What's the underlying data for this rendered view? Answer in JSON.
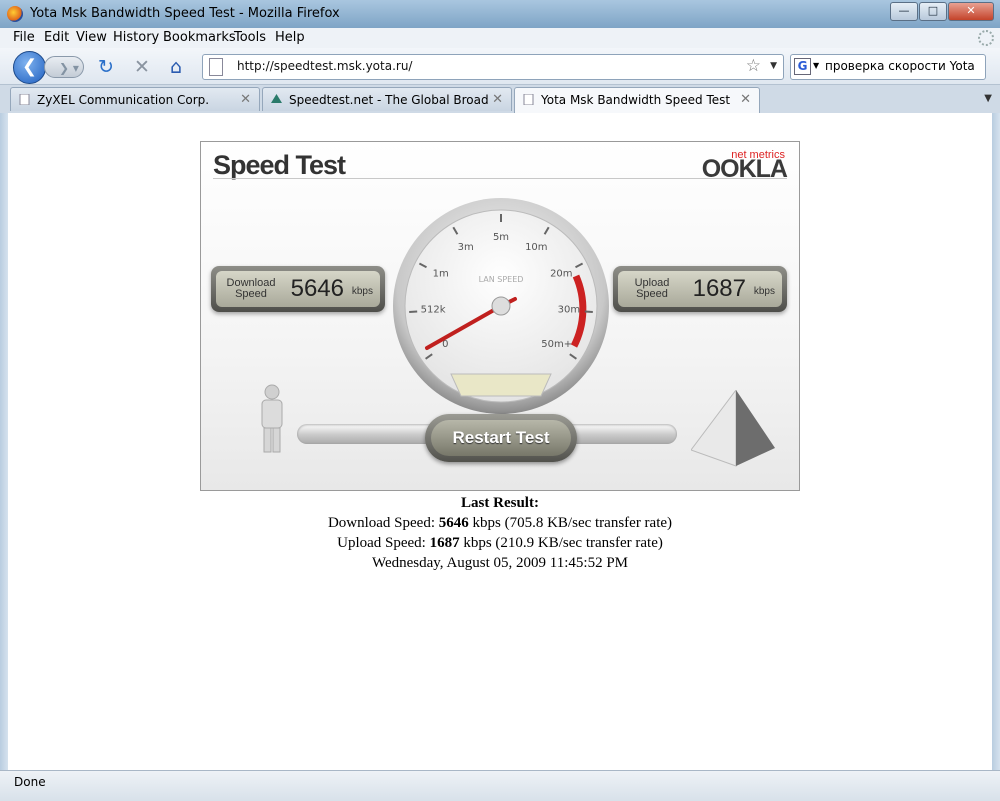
{
  "window": {
    "title": "Yota Msk Bandwidth Speed Test - Mozilla Firefox"
  },
  "menu": [
    "File",
    "Edit",
    "View",
    "History",
    "Bookmarks",
    "Tools",
    "Help"
  ],
  "nav": {
    "url": "http://speedtest.msk.yota.ru/",
    "search_value": "проверка скорости Yota",
    "search_engine_letter": "G"
  },
  "tabs": [
    {
      "label": "ZyXEL Communication Corp.",
      "active": false
    },
    {
      "label": "Speedtest.net - The Global Broadba...",
      "active": false
    },
    {
      "label": "Yota Msk Bandwidth Speed Test",
      "active": true
    }
  ],
  "widget": {
    "title": "Speed Test",
    "brand_sub": "net metrics",
    "brand": "OOKLA",
    "download_label_1": "Download",
    "download_label_2": "Speed",
    "download_value": "5646",
    "upload_label_1": "Upload",
    "upload_label_2": "Speed",
    "upload_value": "1687",
    "unit": "kbps",
    "restart_label": "Restart Test",
    "gauge_center_label": "LAN SPEED",
    "gauge_ticks": [
      "0",
      "512k",
      "1m",
      "3m",
      "5m",
      "10m",
      "20m",
      "30m",
      "50m+"
    ]
  },
  "result": {
    "heading": "Last Result:",
    "download_prefix": "Download Speed: ",
    "download_value": "5646",
    "download_suffix": " kbps (705.8 KB/sec transfer rate)",
    "upload_prefix": "Upload Speed: ",
    "upload_value": "1687",
    "upload_suffix": " kbps (210.9 KB/sec transfer rate)",
    "timestamp": "Wednesday, August 05, 2009 11:45:52 PM"
  },
  "status": {
    "text": "Done"
  },
  "colors": {
    "accent_red": "#cc2222",
    "titlebar": "#8fb2d2"
  }
}
